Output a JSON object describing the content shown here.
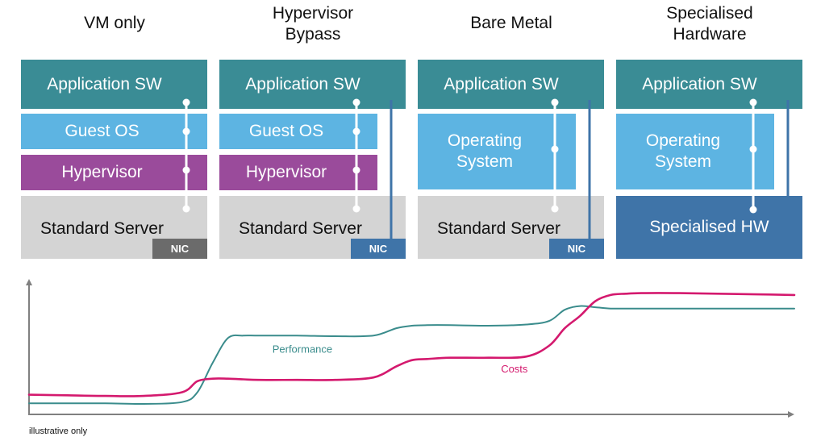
{
  "columns": [
    {
      "title_lines": [
        "VM only"
      ],
      "layers": [
        {
          "kind": "app",
          "label": "Application SW"
        },
        {
          "kind": "guest",
          "label": "Guest OS"
        },
        {
          "kind": "hyp",
          "label": "Hypervisor"
        },
        {
          "kind": "server",
          "label": "Standard Server"
        }
      ],
      "nic": {
        "label": "NIC",
        "style": "gray"
      },
      "bypass": false
    },
    {
      "title_lines": [
        "Hypervisor",
        "Bypass"
      ],
      "layers": [
        {
          "kind": "app",
          "label": "Application SW"
        },
        {
          "kind": "guest",
          "label": "Guest OS"
        },
        {
          "kind": "hyp",
          "label": "Hypervisor"
        },
        {
          "kind": "server",
          "label": "Standard Server"
        }
      ],
      "nic": {
        "label": "NIC",
        "style": "blue"
      },
      "bypass": true
    },
    {
      "title_lines": [
        "Bare Metal"
      ],
      "layers": [
        {
          "kind": "app",
          "label": "Application SW"
        },
        {
          "kind": "os",
          "label": "Operating System"
        },
        {
          "kind": "server",
          "label": "Standard Server"
        }
      ],
      "nic": {
        "label": "NIC",
        "style": "blue"
      },
      "bypass": true
    },
    {
      "title_lines": [
        "Specialised",
        "Hardware"
      ],
      "layers": [
        {
          "kind": "app",
          "label": "Application SW"
        },
        {
          "kind": "os",
          "label": "Operating System"
        },
        {
          "kind": "shw",
          "label": "Specialised HW"
        }
      ],
      "nic": null,
      "bypass": true
    }
  ],
  "colors": {
    "application_sw": "#3a8c95",
    "guest_os": "#5db4e2",
    "hypervisor": "#9a4b9b",
    "standard_server": "#d4d4d4",
    "specialised_hw": "#3f74a8",
    "nic_gray": "#6b6b6b",
    "nic_blue": "#3f74a8",
    "performance": "#3a8c8c",
    "costs": "#d4196e",
    "axis": "#808080"
  },
  "chart_data": {
    "type": "line",
    "title": "",
    "xlabel": "",
    "ylabel": "",
    "x": [
      0,
      0.05,
      0.1,
      0.15,
      0.2,
      0.22,
      0.24,
      0.26,
      0.28,
      0.3,
      0.35,
      0.4,
      0.45,
      0.48,
      0.5,
      0.52,
      0.55,
      0.6,
      0.65,
      0.68,
      0.7,
      0.72,
      0.74,
      0.76,
      0.78,
      0.8,
      0.85,
      0.9,
      0.95,
      1.0
    ],
    "series": [
      {
        "name": "Performance",
        "values": [
          0.09,
          0.09,
          0.09,
          0.085,
          0.1,
          0.18,
          0.42,
          0.62,
          0.64,
          0.64,
          0.64,
          0.635,
          0.64,
          0.7,
          0.72,
          0.725,
          0.725,
          0.72,
          0.73,
          0.76,
          0.85,
          0.88,
          0.87,
          0.86,
          0.86,
          0.86,
          0.86,
          0.86,
          0.86,
          0.86
        ]
      },
      {
        "name": "Costs",
        "values": [
          0.16,
          0.155,
          0.15,
          0.15,
          0.18,
          0.27,
          0.29,
          0.29,
          0.285,
          0.28,
          0.28,
          0.28,
          0.3,
          0.39,
          0.44,
          0.45,
          0.46,
          0.46,
          0.47,
          0.56,
          0.7,
          0.8,
          0.92,
          0.97,
          0.98,
          0.985,
          0.985,
          0.98,
          0.975,
          0.97
        ]
      }
    ],
    "series_labels": [
      "Performance",
      "Costs"
    ],
    "xlim": [
      0,
      1
    ],
    "ylim": [
      0,
      1.1
    ],
    "grid": false,
    "legend": "inline",
    "axes": "arrows, no ticks"
  },
  "footnote": "illustrative only"
}
